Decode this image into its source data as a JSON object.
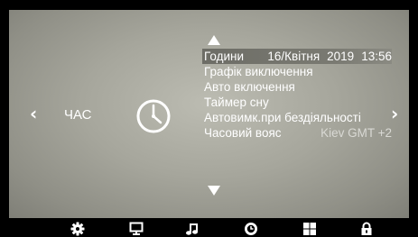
{
  "nav": {
    "left_arrow": "‹",
    "right_arrow": "›"
  },
  "section": {
    "label": "ЧАС",
    "icon": "clock-icon"
  },
  "menu": {
    "items": [
      {
        "label": "Години",
        "value_date": "16/Квітня",
        "value_year": "2019",
        "value_time": "13:56",
        "selected": true
      },
      {
        "label": "Графік виключення"
      },
      {
        "label": "Авто включення"
      },
      {
        "label": "Таймер сну"
      },
      {
        "label": "Автовимк.при бездіяльності"
      },
      {
        "label": "Часовий вояс",
        "value": "Kiev GMT +2"
      }
    ]
  },
  "dock": {
    "icons": [
      "gear-icon",
      "monitor-icon",
      "music-note-icon",
      "clock-icon",
      "grid-icon",
      "lock-icon"
    ],
    "active": "clock-icon"
  },
  "colors": {
    "screen_center": "#bcbcb2",
    "screen_edge": "#7f7f77",
    "highlight": "#6d6d66",
    "frame": "#000000"
  }
}
